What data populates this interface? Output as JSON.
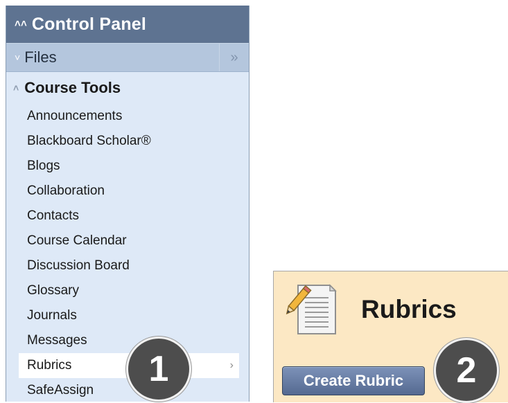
{
  "control_panel": {
    "title": "Control Panel",
    "files_label": "Files",
    "course_tools": {
      "title": "Course Tools",
      "items": [
        {
          "label": "Announcements"
        },
        {
          "label": "Blackboard Scholar®"
        },
        {
          "label": "Blogs"
        },
        {
          "label": "Collaboration"
        },
        {
          "label": "Contacts"
        },
        {
          "label": "Course Calendar"
        },
        {
          "label": "Discussion Board"
        },
        {
          "label": "Glossary"
        },
        {
          "label": "Journals"
        },
        {
          "label": "Messages"
        },
        {
          "label": "Rubrics",
          "selected": true
        },
        {
          "label": "SafeAssign"
        }
      ]
    }
  },
  "rubrics_page": {
    "title": "Rubrics",
    "create_button": "Create Rubric"
  },
  "callouts": {
    "step1": "1",
    "step2": "2"
  },
  "colors": {
    "panel_header": "#5e7391",
    "panel_bg": "#dee9f7",
    "rubrics_bg": "#fce8c4",
    "button": "#667aa1"
  }
}
